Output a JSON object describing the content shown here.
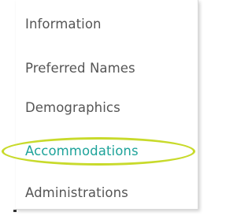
{
  "menu": {
    "items": [
      {
        "label": "Information",
        "active": false
      },
      {
        "label": "Preferred Names",
        "active": false
      },
      {
        "label": "Demographics",
        "active": false
      },
      {
        "label": "Accommodations",
        "active": true
      },
      {
        "label": "Administrations",
        "active": false
      }
    ]
  },
  "colors": {
    "text": "#555555",
    "active_text": "#1ea39a",
    "highlight_annotation": "#c8da2b"
  }
}
